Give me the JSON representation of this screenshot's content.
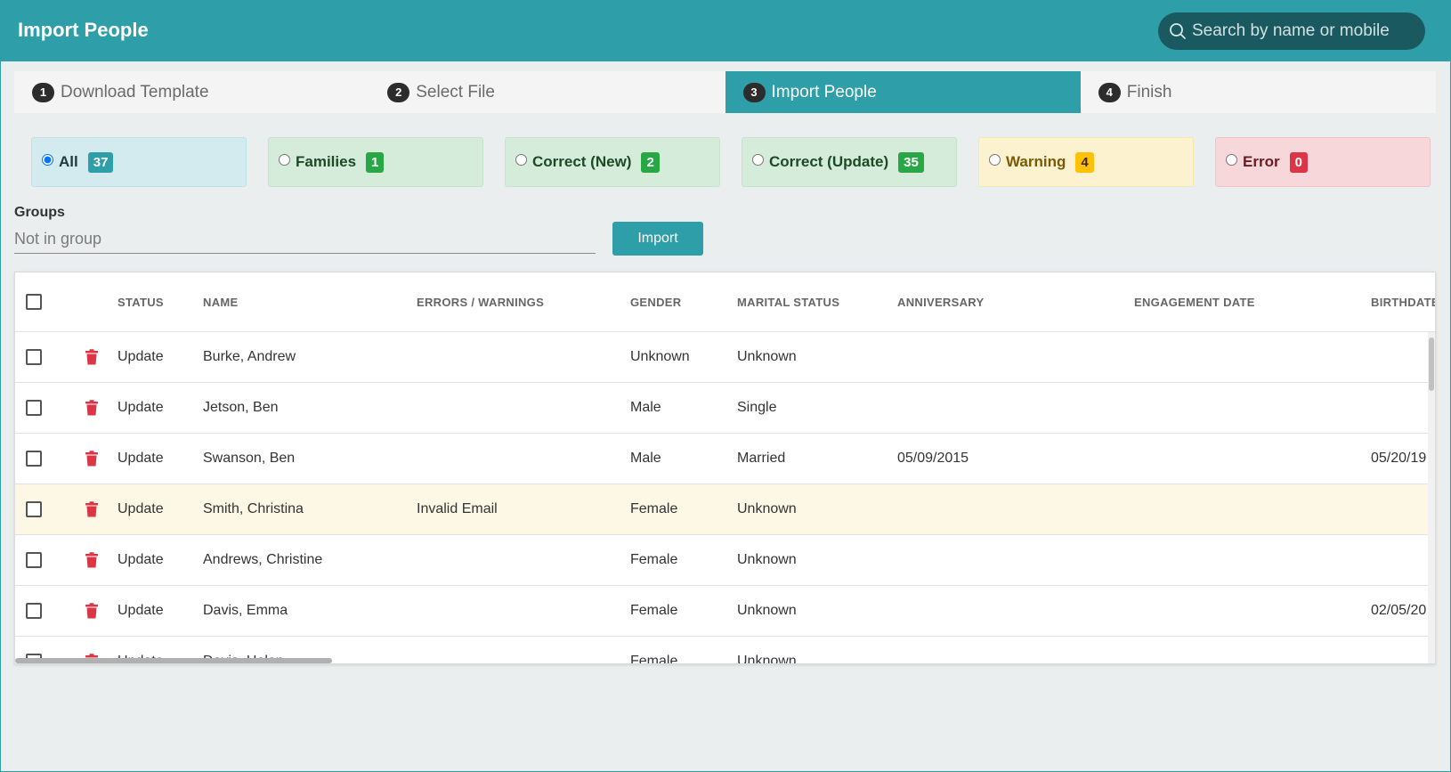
{
  "header": {
    "title": "Import People",
    "search_placeholder": "Search by name or mobile"
  },
  "steps": [
    {
      "num": "1",
      "label": "Download Template"
    },
    {
      "num": "2",
      "label": "Select File"
    },
    {
      "num": "3",
      "label": "Import People"
    },
    {
      "num": "4",
      "label": "Finish"
    }
  ],
  "active_step": 3,
  "filters": [
    {
      "label": "All",
      "count": "37",
      "color": "#2e9ea9"
    },
    {
      "label": "Families",
      "count": "1",
      "color": "#28a745"
    },
    {
      "label": "Correct (New)",
      "count": "2",
      "color": "#28a745"
    },
    {
      "label": "Correct (Update)",
      "count": "35",
      "color": "#28a745"
    },
    {
      "label": "Warning",
      "count": "4",
      "color": "#ffc107"
    },
    {
      "label": "Error",
      "count": "0",
      "color": "#dc3545"
    }
  ],
  "groups": {
    "label": "Groups",
    "placeholder": "Not in group",
    "import_label": "Import"
  },
  "table": {
    "columns": [
      "STATUS",
      "NAME",
      "ERRORS / WARNINGS",
      "GENDER",
      "MARITAL STATUS",
      "ANNIVERSARY",
      "ENGAGEMENT DATE",
      "BIRTHDATE"
    ],
    "rows": [
      {
        "status": "Update",
        "name": "Burke, Andrew",
        "errors": "",
        "gender": "Unknown",
        "marital": "Unknown",
        "anniversary": "",
        "engagement": "",
        "birthdate": ""
      },
      {
        "status": "Update",
        "name": "Jetson, Ben",
        "errors": "",
        "gender": "Male",
        "marital": "Single",
        "anniversary": "",
        "engagement": "",
        "birthdate": ""
      },
      {
        "status": "Update",
        "name": "Swanson, Ben",
        "errors": "",
        "gender": "Male",
        "marital": "Married",
        "anniversary": "05/09/2015",
        "engagement": "",
        "birthdate": "05/20/19"
      },
      {
        "status": "Update",
        "name": "Smith, Christina",
        "errors": "Invalid Email",
        "gender": "Female",
        "marital": "Unknown",
        "anniversary": "",
        "engagement": "",
        "birthdate": ""
      },
      {
        "status": "Update",
        "name": "Andrews, Christine",
        "errors": "",
        "gender": "Female",
        "marital": "Unknown",
        "anniversary": "",
        "engagement": "",
        "birthdate": ""
      },
      {
        "status": "Update",
        "name": "Davis, Emma",
        "errors": "",
        "gender": "Female",
        "marital": "Unknown",
        "anniversary": "",
        "engagement": "",
        "birthdate": "02/05/20"
      },
      {
        "status": "Update",
        "name": "Davis, Helen",
        "errors": "",
        "gender": "Female",
        "marital": "Unknown",
        "anniversary": "",
        "engagement": "",
        "birthdate": ""
      }
    ]
  },
  "colors": {
    "accent": "#2e9ea9",
    "delete": "#dc3545",
    "warning_row": "#fdf8e5"
  }
}
